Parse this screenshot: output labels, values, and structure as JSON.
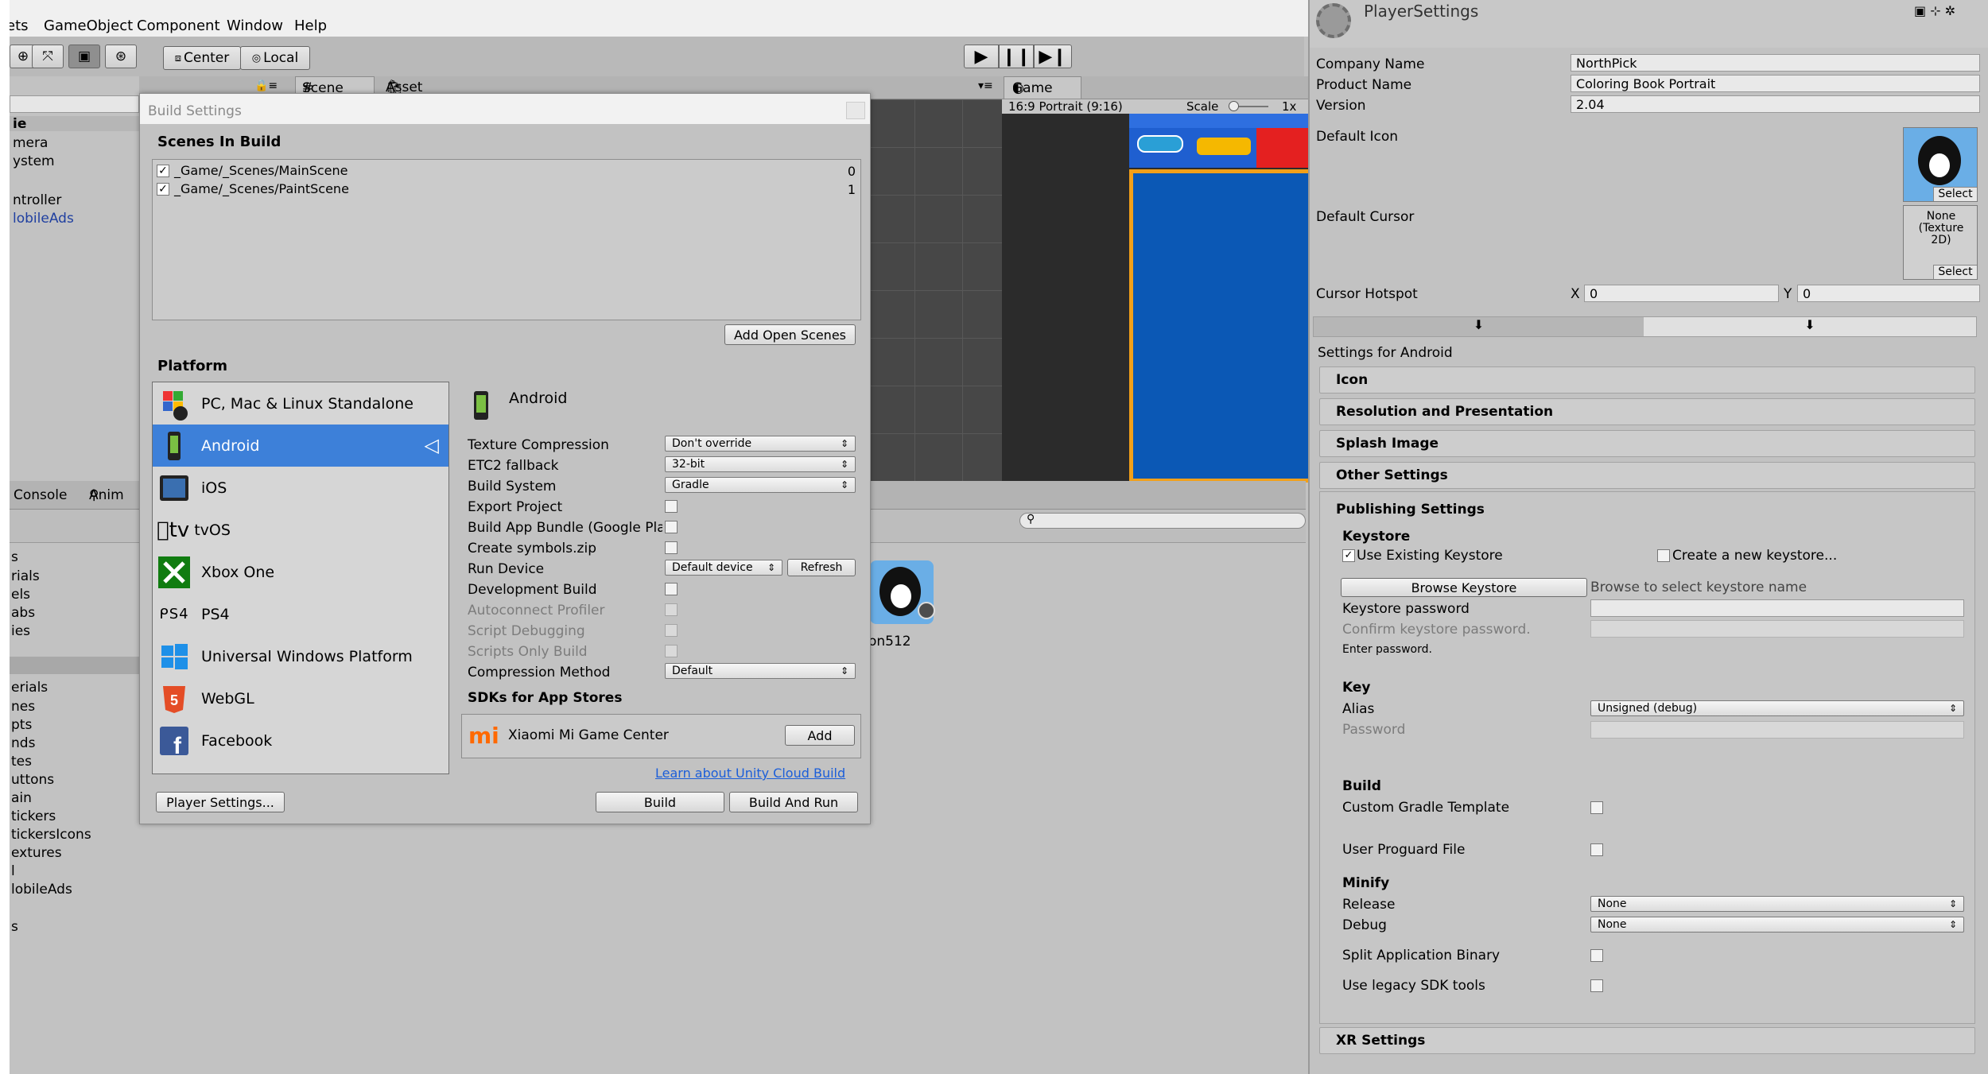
{
  "menu": {
    "items": [
      "ets",
      "GameObject",
      "Component",
      "Window",
      "Help"
    ]
  },
  "toolbar": {
    "center_label": "Center",
    "local_label": "Local"
  },
  "scene_tabs": {
    "scene": "Scene",
    "asset_store": "Asset Store",
    "game": "Game",
    "game_aspect": "16:9 Portrait (9:16)",
    "scale_label": "Scale",
    "scale_value": "1x"
  },
  "hierarchy": {
    "items": [
      "ie",
      "mera",
      "ystem",
      "ntroller",
      "lobileAds"
    ]
  },
  "bottom_tabs": {
    "console": "Console",
    "anim": "Anim"
  },
  "project": {
    "left_items_top": [
      "s",
      "rials",
      "els",
      "abs",
      "ies"
    ],
    "left_items_bottom": [
      "erials",
      "nes",
      "pts",
      "nds",
      "tes",
      "uttons",
      "ain",
      "tickers",
      "tickersIcons",
      "extures",
      "l",
      "lobileAds",
      "s"
    ],
    "asset_label": "on512"
  },
  "build_settings": {
    "title": "Build Settings",
    "scenes_header": "Scenes In Build",
    "scenes": [
      {
        "path": "_Game/_Scenes/MainScene",
        "index": "0"
      },
      {
        "path": "_Game/_Scenes/PaintScene",
        "index": "1"
      }
    ],
    "add_open_scenes": "Add Open Scenes",
    "platform_header": "Platform",
    "platforms": [
      "PC, Mac & Linux Standalone",
      "Android",
      "iOS",
      "tvOS",
      "Xbox One",
      "PS4",
      "Universal Windows Platform",
      "WebGL",
      "Facebook"
    ],
    "selected_platform": "Android",
    "settings": {
      "texture_compression": {
        "label": "Texture Compression",
        "value": "Don't override"
      },
      "etc2_fallback": {
        "label": "ETC2 fallback",
        "value": "32-bit"
      },
      "build_system": {
        "label": "Build System",
        "value": "Gradle"
      },
      "export_project": "Export Project",
      "build_app_bundle": "Build App Bundle (Google Pla",
      "create_symbols": "Create symbols.zip",
      "run_device": {
        "label": "Run Device",
        "value": "Default device",
        "refresh": "Refresh"
      },
      "development_build": "Development Build",
      "autoconnect_profiler": "Autoconnect Profiler",
      "script_debugging": "Script Debugging",
      "scripts_only": "Scripts Only Build",
      "compression_method": {
        "label": "Compression Method",
        "value": "Default"
      }
    },
    "sdks_header": "SDKs for App Stores",
    "sdk_name": "Xiaomi Mi Game Center",
    "sdk_add": "Add",
    "cloud_link": "Learn about Unity Cloud Build",
    "player_settings_btn": "Player Settings...",
    "build_btn": "Build",
    "build_and_run_btn": "Build And Run"
  },
  "inspector": {
    "title": "PlayerSettings",
    "company_name": {
      "label": "Company Name",
      "value": "NorthPick"
    },
    "product_name": {
      "label": "Product Name",
      "value": "Coloring Book Portrait"
    },
    "version": {
      "label": "Version",
      "value": "2.04"
    },
    "default_icon": "Default Icon",
    "default_cursor": "Default Cursor",
    "cursor_none": "None (Texture 2D)",
    "select": "Select",
    "cursor_hotspot": {
      "label": "Cursor Hotspot",
      "x_label": "X",
      "x": "0",
      "y_label": "Y",
      "y": "0"
    },
    "settings_for": "Settings for Android",
    "sections": [
      "Icon",
      "Resolution and Presentation",
      "Splash Image",
      "Other Settings"
    ],
    "publishing": {
      "title": "Publishing Settings",
      "keystore_header": "Keystore",
      "use_existing": "Use Existing Keystore",
      "create_new": "Create a new keystore...",
      "browse_btn": "Browse Keystore",
      "browse_hint": "Browse to select keystore name",
      "keystore_password": "Keystore password",
      "confirm_password": "Confirm keystore password.",
      "enter_password": "Enter password.",
      "key_header": "Key",
      "alias": {
        "label": "Alias",
        "value": "Unsigned (debug)"
      },
      "password": "Password",
      "build_header": "Build",
      "custom_gradle": "Custom Gradle Template",
      "user_proguard": "User Proguard File",
      "minify_header": "Minify",
      "release": {
        "label": "Release",
        "value": "None"
      },
      "debug": {
        "label": "Debug",
        "value": "None"
      },
      "split_binary": "Split Application Binary",
      "legacy_sdk": "Use legacy SDK tools"
    },
    "xr_settings": "XR Settings"
  }
}
